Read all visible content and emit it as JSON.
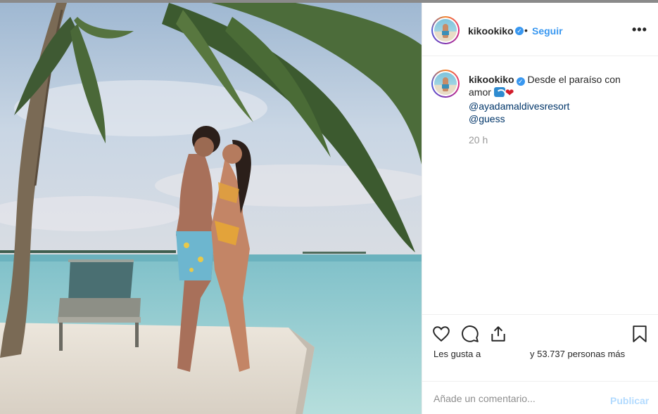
{
  "post": {
    "username": "kikookiko",
    "verified_icon": "verified-badge-icon",
    "separator": "•",
    "follow_label": "Seguir",
    "more_label": "•••",
    "caption": {
      "username": "kikookiko",
      "text_line1": "Desde el paraíso con",
      "text_line2": "amor",
      "emoji_wave": "water-wave-emoji",
      "emoji_heart": "❤",
      "mention1": "@ayadamaldivesresort",
      "mention2": "@guess",
      "time": "20 h"
    },
    "actions": {
      "like_icon": "heart-icon",
      "comment_icon": "comment-icon",
      "share_icon": "share-icon",
      "save_icon": "bookmark-icon",
      "likes_prefix": "Les gusta a",
      "likes_suffix": "y 53.737 personas más"
    },
    "comment_box": {
      "placeholder": "Añade un comentario...",
      "publish_label": "Publicar"
    }
  },
  "colors": {
    "accent": "#3897f0",
    "publish_disabled": "#b3dbff",
    "heart": "#d21c2a"
  }
}
